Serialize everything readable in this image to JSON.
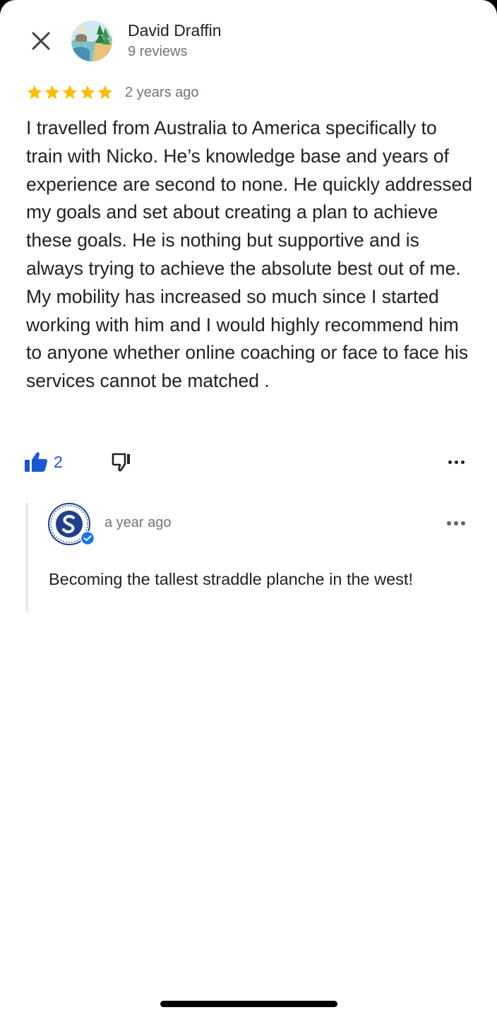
{
  "header": {
    "author_name": "David Draffin",
    "author_reviews": "9 reviews",
    "close_icon": "close-icon",
    "avatar_icon": "landscape-avatar"
  },
  "review": {
    "rating": 5,
    "rating_max": 5,
    "time": "2 years ago",
    "text": "I travelled from Australia to America specifically to train with Nicko. He’s knowledge base and years of experience are second to none. He quickly addressed my goals and set about creating a plan to achieve these goals. He is nothing but supportive and is always trying to achieve the absolute best out of me. My mobility has increased so much since I started working with him and I would highly recommend him to anyone whether online coaching or face to face his services cannot be matched .",
    "like_count": "2",
    "like_icon": "thumbs-up-icon",
    "dislike_icon": "thumbs-down-icon",
    "more_icon": "more-horiz-icon"
  },
  "owner_reply": {
    "time": "a year ago",
    "text": "Becoming the tallest straddle planche in the west!",
    "avatar_icon": "business-logo",
    "verified_icon": "verified-badge-icon",
    "more_icon": "more-horiz-icon"
  },
  "colors": {
    "star": "#fbbc04",
    "accent_blue": "#1a56d6",
    "secondary_text": "#70757a",
    "primary_text": "#202124"
  }
}
